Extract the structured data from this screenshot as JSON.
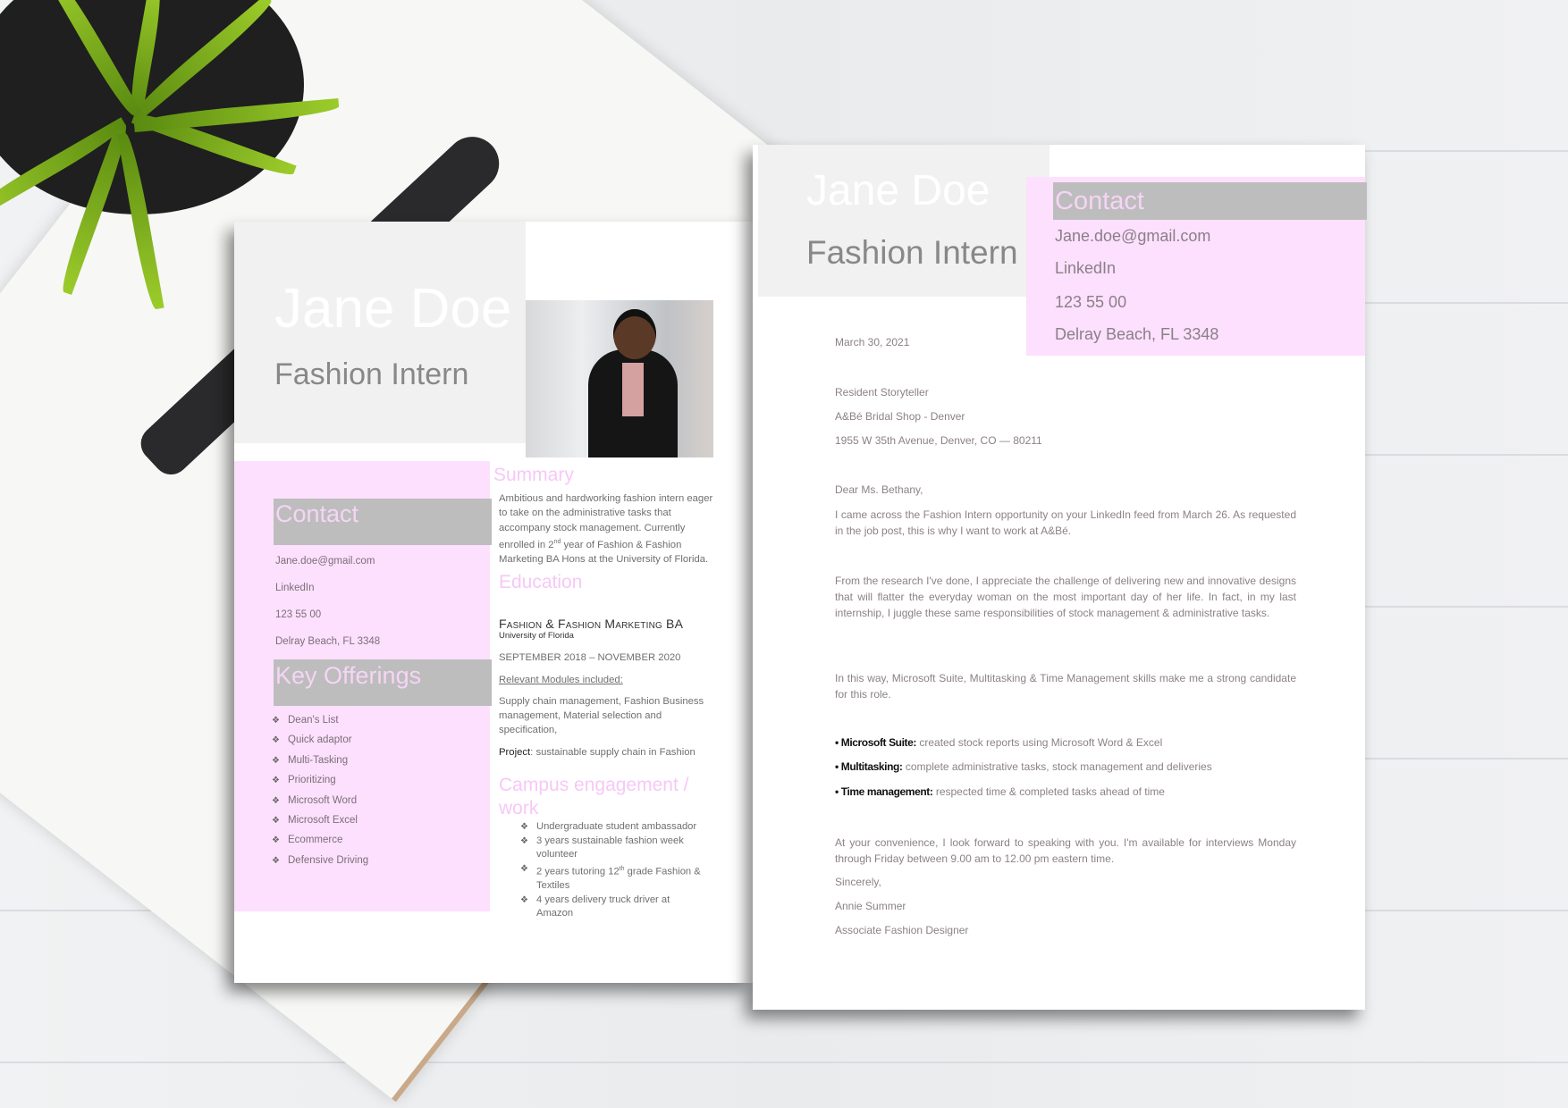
{
  "resume": {
    "name": "Jane Doe",
    "title": "Fashion Intern",
    "contact": {
      "heading": "Contact",
      "email": "Jane.doe@gmail.com",
      "linkedin": "LinkedIn",
      "phone": "123 55 00",
      "location": "Delray Beach, FL 3348"
    },
    "key_offerings": {
      "heading": "Key Offerings",
      "bullet": "❖",
      "items": [
        "Dean's List",
        "Quick adaptor",
        "Multi-Tasking",
        "Prioritizing",
        "Microsoft Word",
        "Microsoft Excel",
        "Ecommerce",
        "Defensive Driving"
      ]
    },
    "summary": {
      "heading": "Summary",
      "text_a": "Ambitious and hardworking fashion intern eager to take on the administrative tasks that accompany stock management.  Currently enrolled in 2",
      "sup": "nd",
      "text_b": " year of Fashion & Fashion Marketing BA Hons at the University of Florida."
    },
    "education": {
      "heading": "Education",
      "degree": "Fashion & Fashion Marketing BA",
      "school": "University of Florida",
      "dates": "SEPTEMBER  2018 – NOVEMBER 2020",
      "modules_label": "Relevant Modules included:",
      "modules": "Supply chain management, Fashion Business management, Material selection and specification,",
      "project_label": "Project",
      "project": ": sustainable supply chain in Fashion"
    },
    "campus": {
      "heading": "Campus engagement / work",
      "bullet": "❖",
      "items": [
        {
          "a": "Undergraduate student ambassador",
          "sup": "",
          "b": ""
        },
        {
          "a": "3 years sustainable fashion week volunteer",
          "sup": "",
          "b": ""
        },
        {
          "a": "2 years tutoring 12",
          "sup": "th",
          "b": " grade Fashion & Textiles"
        },
        {
          "a": "4 years delivery truck driver at Amazon",
          "sup": "",
          "b": ""
        }
      ]
    }
  },
  "cover_letter": {
    "name": "Jane Doe",
    "title": "Fashion Intern",
    "contact": {
      "heading": "Contact",
      "email": "Jane.doe@gmail.com",
      "linkedin": "LinkedIn",
      "phone": "123 55 00",
      "location": "Delray Beach, FL 3348"
    },
    "date": "March 30, 2021",
    "recipient": [
      "Resident Storyteller",
      "A&Bé Bridal Shop - Denver",
      "1955 W 35th Avenue, Denver, CO — 80211"
    ],
    "salutation": "Dear Ms. Bethany,",
    "paragraphs": [
      "I came across the Fashion Intern opportunity on your LinkedIn feed from March 26. As requested in the job post, this is why I want to work at A&Bé.",
      "From the research I've done, I appreciate the challenge of delivering new and innovative designs that will flatter the everyday woman on the most important day of her life. In fact, in my last internship, I juggle these same responsibilities of stock management & administrative tasks.",
      "In this way, Microsoft Suite, Multitasking & Time Management skills make me a strong candidate for this role."
    ],
    "skills": [
      {
        "label": "• Microsoft Suite:",
        "text": " created stock reports using Microsoft Word & Excel"
      },
      {
        "label": "• Multitasking:",
        "text": " complete administrative tasks, stock management and deliveries"
      },
      {
        "label": "• Time management:",
        "text": " respected time & completed tasks ahead of time"
      }
    ],
    "closing_paragraph": "At your convenience, I look forward to speaking with you. I'm available for interviews Monday through Friday between 9.00 am to 12.00 pm eastern time.",
    "signoff": "Sincerely,",
    "signer_name": "Annie Summer",
    "signer_title": "Associate Fashion Designer"
  }
}
